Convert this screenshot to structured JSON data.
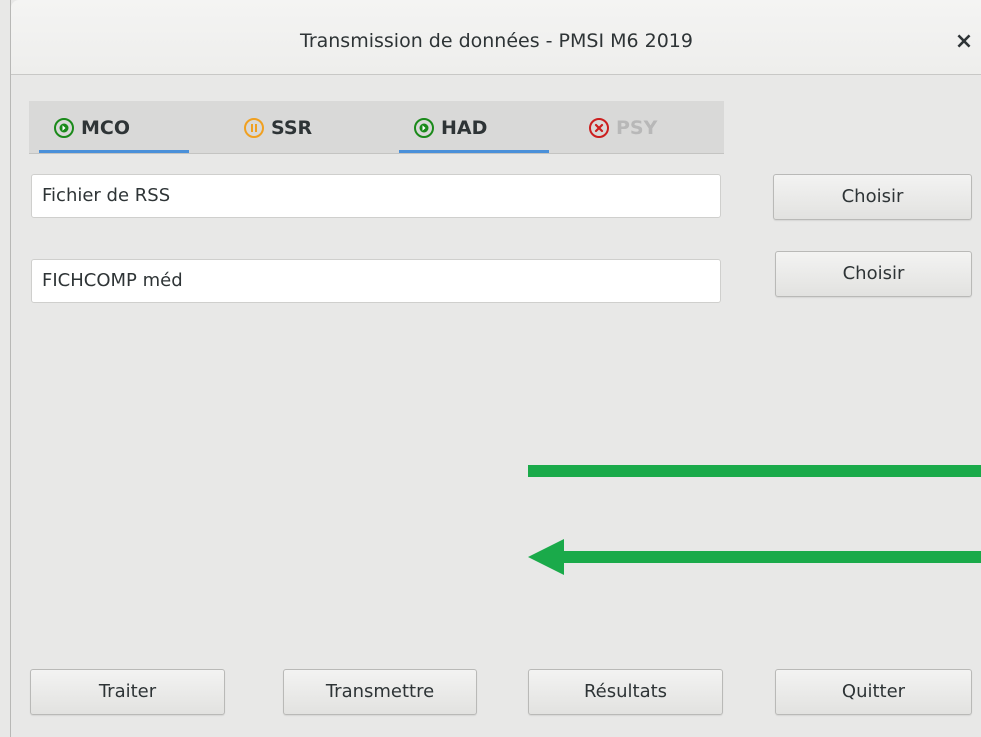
{
  "window": {
    "title": "Transmission de données - PMSI M6 2019",
    "close_label": "×"
  },
  "tabs": [
    {
      "label": "MCO",
      "status_icon": "arrow-right-circle-icon",
      "color": "#2e3436",
      "icon_color": "#1a8a1a",
      "active": true
    },
    {
      "label": "SSR",
      "status_icon": "pause-circle-icon",
      "color": "#2e3436",
      "icon_color": "#f0a020",
      "active": false
    },
    {
      "label": "HAD",
      "status_icon": "arrow-right-circle-icon",
      "color": "#2e3436",
      "icon_color": "#1a8a1a",
      "active": true
    },
    {
      "label": "PSY",
      "status_icon": "x-circle-icon",
      "color": "#b8b8b8",
      "icon_color": "#cc1f1f",
      "active": false
    }
  ],
  "fields": {
    "rss_file": {
      "value": "Fichier de RSS"
    },
    "fichcomp_file": {
      "value": "FICHCOMP méd"
    }
  },
  "buttons": {
    "choose_rss": "Choisir",
    "choose_fichcomp": "Choisir",
    "process": "Traiter",
    "transmit": "Transmettre",
    "results": "Résultats",
    "quit": "Quitter"
  },
  "colors": {
    "accent_underline": "#4a90d9",
    "arrow_green": "#1aaa4a"
  }
}
